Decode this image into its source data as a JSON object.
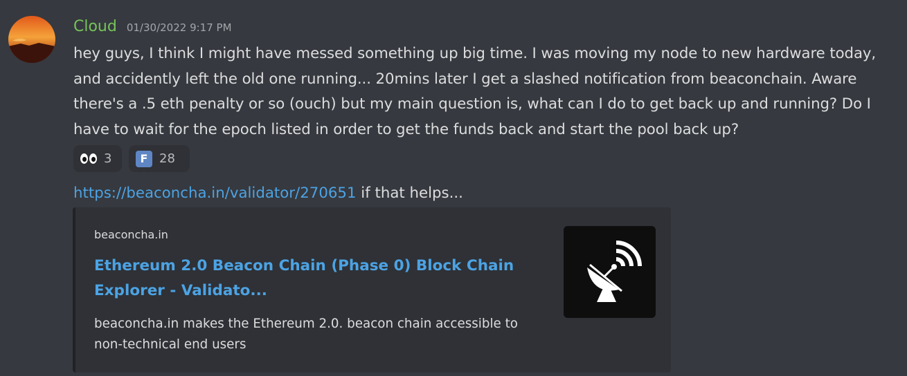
{
  "message": {
    "username": "Cloud",
    "timestamp": "01/30/2022 9:17 PM",
    "text": "hey guys, I think I might have messed something up big time. I was moving my node to new hardware today, and accidently left the old one running... 20mins later I get a slashed notification from beaconchain. Aware there's a .5 eth penalty or so (ouch) but my main question is, what can I do to get back up and running? Do I have to wait for the epoch listed in order to get the funds back and start the pool back up?",
    "username_color": "#76c35a"
  },
  "reactions": [
    {
      "emoji": "eyes-icon",
      "count": "3"
    },
    {
      "emoji": "F",
      "count": "28"
    }
  ],
  "followup": {
    "link": "https://beaconcha.in/validator/270651",
    "text": " if that helps..."
  },
  "embed": {
    "provider": "beaconcha.in",
    "title": "Ethereum 2.0 Beacon Chain (Phase 0) Block Chain Explorer - Validato...",
    "description": "beaconcha.in makes the Ethereum 2.0. beacon chain accessible to non-technical end users",
    "thumbnail_icon": "satellite-dish-icon",
    "link_color": "#4ca3e4"
  }
}
